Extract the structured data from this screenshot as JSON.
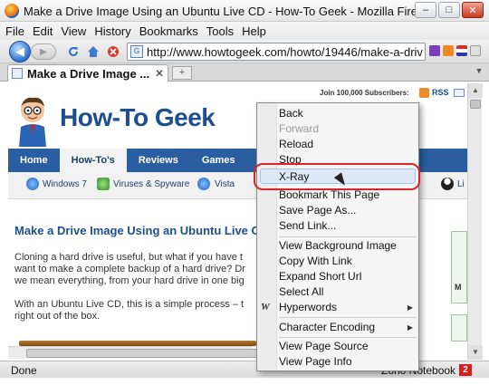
{
  "window": {
    "title": "Make a Drive Image Using an Ubuntu Live CD - How-To Geek - Mozilla Firefox",
    "minimize": "–",
    "maximize": "□",
    "close": "✕"
  },
  "menubar": [
    "File",
    "Edit",
    "View",
    "History",
    "Bookmarks",
    "Tools",
    "Help"
  ],
  "toolbar": {
    "back": "◀",
    "forward": "▶",
    "reload_icon": "reload-icon",
    "stop_icon": "stop-icon",
    "home_icon": "home-icon"
  },
  "urlbar": {
    "url": "http://www.howtogeek.com/howto/19446/make-a-driv"
  },
  "tabs": [
    {
      "title": "Make a Drive Image ...",
      "close": "✕"
    }
  ],
  "newtab": "+",
  "page": {
    "subscribe": "Join 100,000 Subscribers:",
    "rss": "RSS",
    "logo": "How-To Geek",
    "nav": [
      "Home",
      "How-To's",
      "Reviews",
      "Games",
      "S"
    ],
    "categories": [
      "Windows 7",
      "Viruses & Spyware",
      "Vista",
      "Li"
    ],
    "article_title": "Make a Drive Image Using an Ubuntu Live C",
    "paragraphs": [
      "Cloning a hard drive is useful, but what if you have t",
      "want to make a complete backup of a hard drive? Dr",
      "we mean everything, from your hard drive in one big",
      "With an Ubuntu Live CD, this is a simple process – t",
      "right out of the box."
    ],
    "sidebox_letter": "M"
  },
  "context_menu": {
    "items": [
      {
        "label": "Back",
        "disabled": false
      },
      {
        "label": "Forward",
        "disabled": true
      },
      {
        "label": "Reload",
        "disabled": false
      },
      {
        "label": "Stop",
        "disabled": false
      },
      {
        "label": "X-Ray",
        "disabled": false,
        "highlighted": true
      },
      {
        "label": "Bookmark This Page",
        "disabled": false
      },
      {
        "label": "Save Page As...",
        "disabled": false
      },
      {
        "label": "Send Link...",
        "disabled": false
      },
      {
        "label": "View Background Image",
        "disabled": false
      },
      {
        "label": "Copy With Link",
        "disabled": false
      },
      {
        "label": "Expand Short Url",
        "disabled": false
      },
      {
        "label": "Select All",
        "disabled": false
      },
      {
        "label": "Hyperwords",
        "disabled": false,
        "submenu": true
      },
      {
        "label": "Character Encoding",
        "disabled": false,
        "submenu": true
      },
      {
        "label": "View Page Source",
        "disabled": false
      },
      {
        "label": "View Page Info",
        "disabled": false
      }
    ]
  },
  "statusbar": {
    "status": "Done",
    "right": "Zoho Notebook",
    "badge": "2"
  },
  "colors": {
    "brand": "#1c4f91",
    "nav_bg": "#2a5ea0",
    "highlight_ring": "#d9262c"
  }
}
